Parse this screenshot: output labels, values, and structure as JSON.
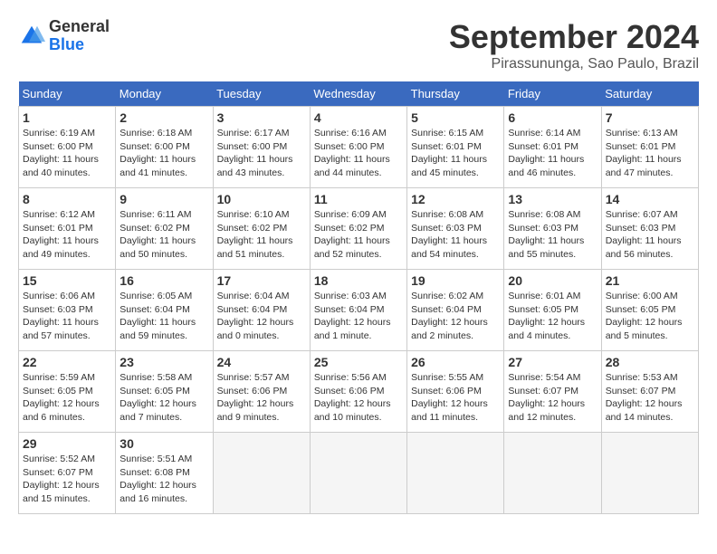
{
  "header": {
    "logo": {
      "line1": "General",
      "line2": "Blue"
    },
    "title": "September 2024",
    "location": "Pirassununga, Sao Paulo, Brazil"
  },
  "weekdays": [
    "Sunday",
    "Monday",
    "Tuesday",
    "Wednesday",
    "Thursday",
    "Friday",
    "Saturday"
  ],
  "weeks": [
    [
      {
        "day": "1",
        "sunrise": "6:19 AM",
        "sunset": "6:00 PM",
        "daylight": "11 hours and 40 minutes."
      },
      {
        "day": "2",
        "sunrise": "6:18 AM",
        "sunset": "6:00 PM",
        "daylight": "11 hours and 41 minutes."
      },
      {
        "day": "3",
        "sunrise": "6:17 AM",
        "sunset": "6:00 PM",
        "daylight": "11 hours and 43 minutes."
      },
      {
        "day": "4",
        "sunrise": "6:16 AM",
        "sunset": "6:00 PM",
        "daylight": "11 hours and 44 minutes."
      },
      {
        "day": "5",
        "sunrise": "6:15 AM",
        "sunset": "6:01 PM",
        "daylight": "11 hours and 45 minutes."
      },
      {
        "day": "6",
        "sunrise": "6:14 AM",
        "sunset": "6:01 PM",
        "daylight": "11 hours and 46 minutes."
      },
      {
        "day": "7",
        "sunrise": "6:13 AM",
        "sunset": "6:01 PM",
        "daylight": "11 hours and 47 minutes."
      }
    ],
    [
      {
        "day": "8",
        "sunrise": "6:12 AM",
        "sunset": "6:01 PM",
        "daylight": "11 hours and 49 minutes."
      },
      {
        "day": "9",
        "sunrise": "6:11 AM",
        "sunset": "6:02 PM",
        "daylight": "11 hours and 50 minutes."
      },
      {
        "day": "10",
        "sunrise": "6:10 AM",
        "sunset": "6:02 PM",
        "daylight": "11 hours and 51 minutes."
      },
      {
        "day": "11",
        "sunrise": "6:09 AM",
        "sunset": "6:02 PM",
        "daylight": "11 hours and 52 minutes."
      },
      {
        "day": "12",
        "sunrise": "6:08 AM",
        "sunset": "6:03 PM",
        "daylight": "11 hours and 54 minutes."
      },
      {
        "day": "13",
        "sunrise": "6:08 AM",
        "sunset": "6:03 PM",
        "daylight": "11 hours and 55 minutes."
      },
      {
        "day": "14",
        "sunrise": "6:07 AM",
        "sunset": "6:03 PM",
        "daylight": "11 hours and 56 minutes."
      }
    ],
    [
      {
        "day": "15",
        "sunrise": "6:06 AM",
        "sunset": "6:03 PM",
        "daylight": "11 hours and 57 minutes."
      },
      {
        "day": "16",
        "sunrise": "6:05 AM",
        "sunset": "6:04 PM",
        "daylight": "11 hours and 59 minutes."
      },
      {
        "day": "17",
        "sunrise": "6:04 AM",
        "sunset": "6:04 PM",
        "daylight": "12 hours and 0 minutes."
      },
      {
        "day": "18",
        "sunrise": "6:03 AM",
        "sunset": "6:04 PM",
        "daylight": "12 hours and 1 minute."
      },
      {
        "day": "19",
        "sunrise": "6:02 AM",
        "sunset": "6:04 PM",
        "daylight": "12 hours and 2 minutes."
      },
      {
        "day": "20",
        "sunrise": "6:01 AM",
        "sunset": "6:05 PM",
        "daylight": "12 hours and 4 minutes."
      },
      {
        "day": "21",
        "sunrise": "6:00 AM",
        "sunset": "6:05 PM",
        "daylight": "12 hours and 5 minutes."
      }
    ],
    [
      {
        "day": "22",
        "sunrise": "5:59 AM",
        "sunset": "6:05 PM",
        "daylight": "12 hours and 6 minutes."
      },
      {
        "day": "23",
        "sunrise": "5:58 AM",
        "sunset": "6:05 PM",
        "daylight": "12 hours and 7 minutes."
      },
      {
        "day": "24",
        "sunrise": "5:57 AM",
        "sunset": "6:06 PM",
        "daylight": "12 hours and 9 minutes."
      },
      {
        "day": "25",
        "sunrise": "5:56 AM",
        "sunset": "6:06 PM",
        "daylight": "12 hours and 10 minutes."
      },
      {
        "day": "26",
        "sunrise": "5:55 AM",
        "sunset": "6:06 PM",
        "daylight": "12 hours and 11 minutes."
      },
      {
        "day": "27",
        "sunrise": "5:54 AM",
        "sunset": "6:07 PM",
        "daylight": "12 hours and 12 minutes."
      },
      {
        "day": "28",
        "sunrise": "5:53 AM",
        "sunset": "6:07 PM",
        "daylight": "12 hours and 14 minutes."
      }
    ],
    [
      {
        "day": "29",
        "sunrise": "5:52 AM",
        "sunset": "6:07 PM",
        "daylight": "12 hours and 15 minutes."
      },
      {
        "day": "30",
        "sunrise": "5:51 AM",
        "sunset": "6:08 PM",
        "daylight": "12 hours and 16 minutes."
      },
      null,
      null,
      null,
      null,
      null
    ]
  ]
}
